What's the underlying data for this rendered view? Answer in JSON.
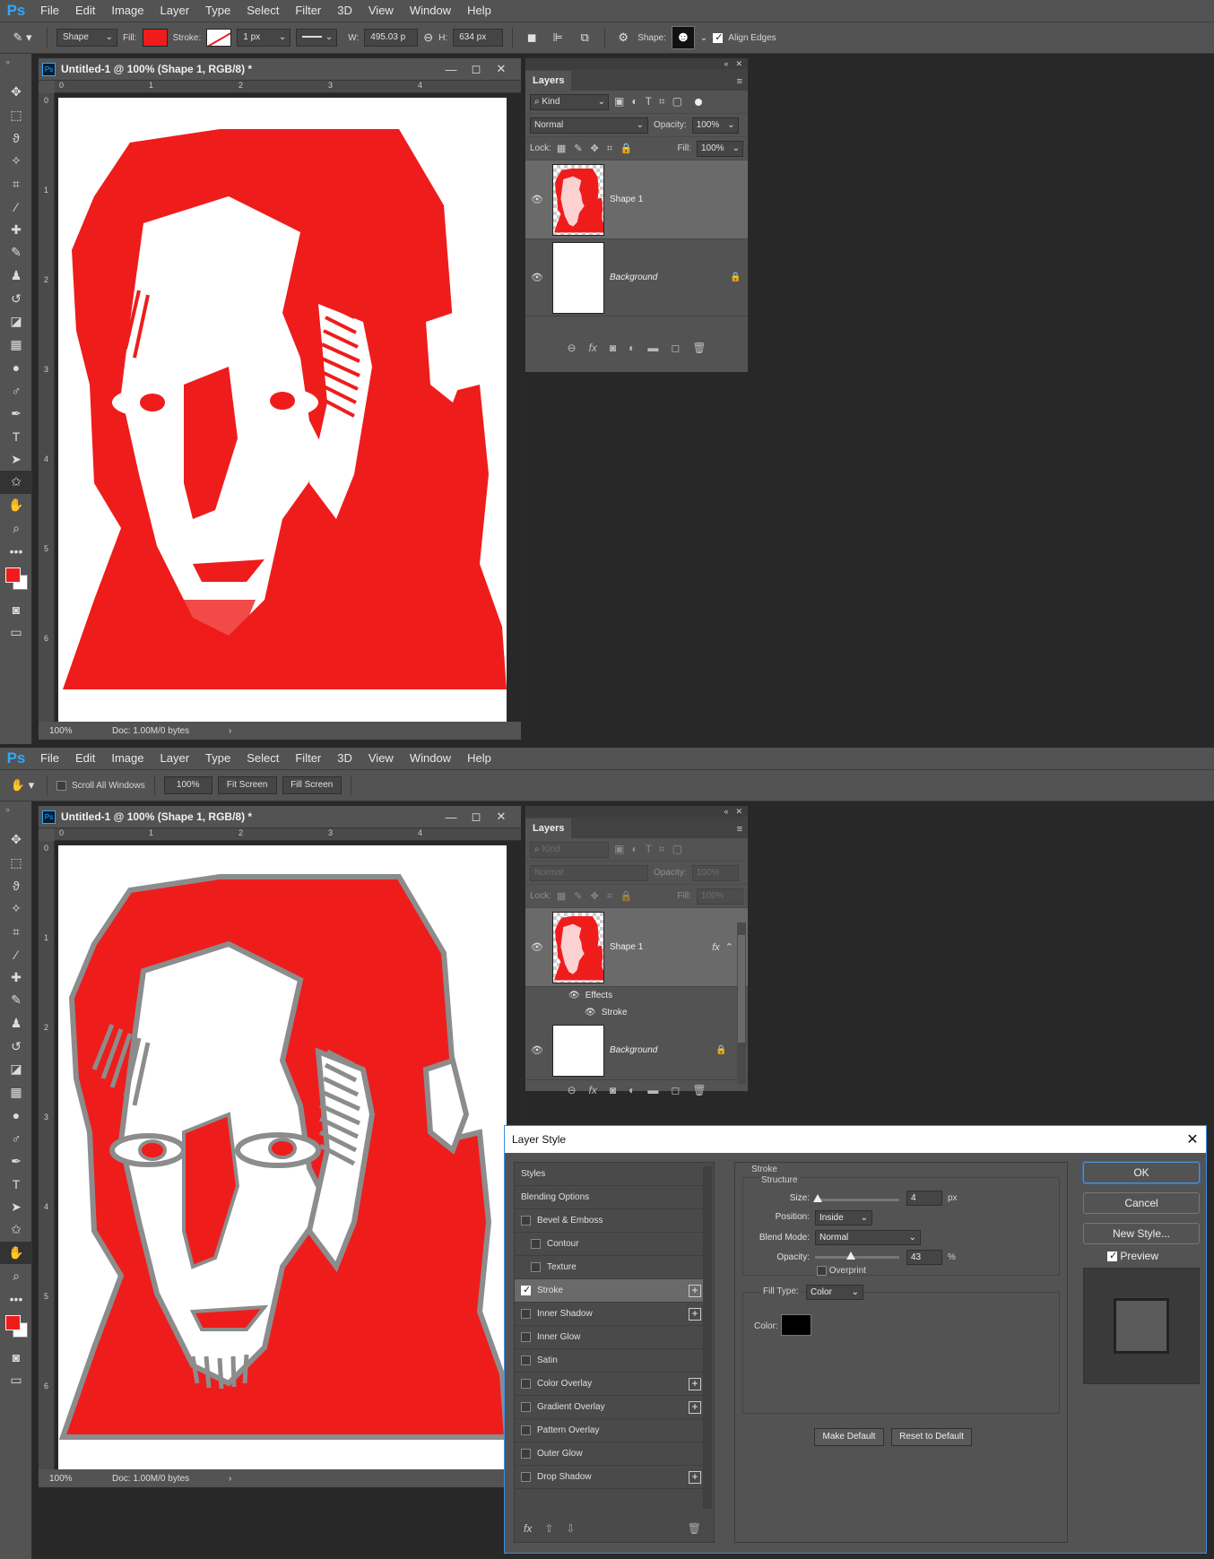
{
  "menu": {
    "logo": "Ps",
    "items": [
      "File",
      "Edit",
      "Image",
      "Layer",
      "Type",
      "Select",
      "Filter",
      "3D",
      "View",
      "Window",
      "Help"
    ]
  },
  "options_top": {
    "mode": "Shape",
    "fill_label": "Fill:",
    "stroke_label": "Stroke:",
    "stroke_width": "1 px",
    "w_label": "W:",
    "w_value": "495.03 p",
    "h_label": "H:",
    "h_value": "634 px",
    "shape_label": "Shape:",
    "align_edges": "Align Edges",
    "fill_color": "#ef1c1c"
  },
  "options_bottom": {
    "scroll_all": "Scroll All Windows",
    "zoom": "100%",
    "fit_screen": "Fit Screen",
    "fill_screen": "Fill Screen"
  },
  "document": {
    "title": "Untitled-1 @ 100% (Shape 1, RGB/8) *",
    "zoom": "100%",
    "doc_info": "Doc: 1.00M/0 bytes",
    "ruler_h": [
      "0",
      "1",
      "2",
      "3",
      "4"
    ],
    "ruler_v": [
      "0",
      "1",
      "2",
      "3",
      "4",
      "5",
      "6"
    ]
  },
  "layers_top": {
    "tab": "Layers",
    "filter": "Kind",
    "blend": "Normal",
    "opacity_label": "Opacity:",
    "opacity": "100%",
    "lock_label": "Lock:",
    "fill_label": "Fill:",
    "fill": "100%",
    "layers": [
      {
        "name": "Shape 1"
      },
      {
        "name": "Background"
      }
    ]
  },
  "layers_bottom": {
    "tab": "Layers",
    "filter": "Kind",
    "blend": "Normal",
    "opacity_label": "Opacity:",
    "opacity": "100%",
    "lock_label": "Lock:",
    "fill_label": "Fill:",
    "fill": "100%",
    "effects_label": "Effects",
    "stroke_label": "Stroke",
    "fx": "fx",
    "layers": [
      {
        "name": "Shape 1"
      },
      {
        "name": "Background"
      }
    ]
  },
  "dialog": {
    "title": "Layer Style",
    "styles": [
      {
        "label": "Styles",
        "check": false,
        "has_box": false,
        "indent": false,
        "plus": false,
        "selected": false
      },
      {
        "label": "Blending Options",
        "check": false,
        "has_box": false,
        "indent": false,
        "plus": false,
        "selected": false
      },
      {
        "label": "Bevel & Emboss",
        "check": false,
        "has_box": true,
        "indent": false,
        "plus": false,
        "selected": false
      },
      {
        "label": "Contour",
        "check": false,
        "has_box": true,
        "indent": true,
        "plus": false,
        "selected": false
      },
      {
        "label": "Texture",
        "check": false,
        "has_box": true,
        "indent": true,
        "plus": false,
        "selected": false
      },
      {
        "label": "Stroke",
        "check": true,
        "has_box": true,
        "indent": false,
        "plus": true,
        "selected": true
      },
      {
        "label": "Inner Shadow",
        "check": false,
        "has_box": true,
        "indent": false,
        "plus": true,
        "selected": false
      },
      {
        "label": "Inner Glow",
        "check": false,
        "has_box": true,
        "indent": false,
        "plus": false,
        "selected": false
      },
      {
        "label": "Satin",
        "check": false,
        "has_box": true,
        "indent": false,
        "plus": false,
        "selected": false
      },
      {
        "label": "Color Overlay",
        "check": false,
        "has_box": true,
        "indent": false,
        "plus": true,
        "selected": false
      },
      {
        "label": "Gradient Overlay",
        "check": false,
        "has_box": true,
        "indent": false,
        "plus": true,
        "selected": false
      },
      {
        "label": "Pattern Overlay",
        "check": false,
        "has_box": true,
        "indent": false,
        "plus": false,
        "selected": false
      },
      {
        "label": "Outer Glow",
        "check": false,
        "has_box": true,
        "indent": false,
        "plus": false,
        "selected": false
      },
      {
        "label": "Drop Shadow",
        "check": false,
        "has_box": true,
        "indent": false,
        "plus": true,
        "selected": false
      }
    ],
    "stroke": {
      "section": "Stroke",
      "structure": "Structure",
      "size_label": "Size:",
      "size": "4",
      "size_unit": "px",
      "position_label": "Position:",
      "position": "Inside",
      "blend_label": "Blend Mode:",
      "blend": "Normal",
      "opacity_label": "Opacity:",
      "opacity": "43",
      "opacity_unit": "%",
      "opacity_fraction": 0.43,
      "overprint": "Overprint",
      "fill_type_label": "Fill Type:",
      "fill_type": "Color",
      "color_label": "Color:",
      "color": "#000000",
      "make_default": "Make Default",
      "reset_default": "Reset to Default"
    },
    "buttons": {
      "ok": "OK",
      "cancel": "Cancel",
      "new_style": "New Style...",
      "preview": "Preview"
    }
  },
  "colors": {
    "red": "#ef1c1c",
    "stroke_gray": "#8c8c8c"
  }
}
